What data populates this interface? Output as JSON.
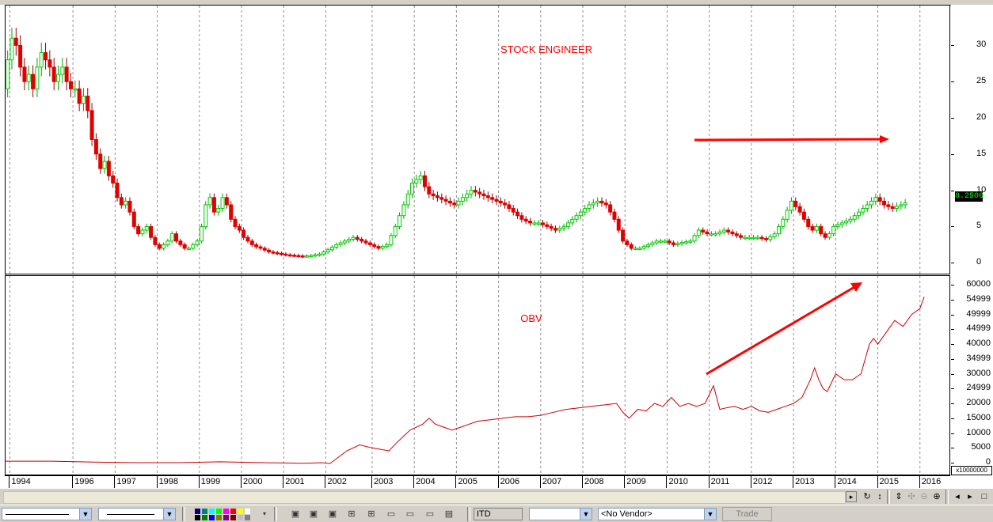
{
  "window": {
    "title": "ITD"
  },
  "chart_data": [
    {
      "type": "candlestick",
      "title": "STOCK ENGINEER",
      "yaxis": {
        "ticks": [
          0,
          5,
          10,
          15,
          20,
          25,
          30
        ],
        "ylim": [
          -1.5,
          35.5
        ],
        "side": "right"
      },
      "last_value_label": "8.2500",
      "xlim": [
        1993.9,
        2016.3
      ],
      "close_series": {
        "x": [
          1993.9,
          1994.0,
          1994.1,
          1994.2,
          1994.3,
          1994.4,
          1994.5,
          1994.6,
          1994.7,
          1994.8,
          1994.9,
          1995.0,
          1995.1,
          1995.2,
          1995.3,
          1995.4,
          1995.5,
          1995.6,
          1995.7,
          1995.8,
          1995.9,
          1996.0,
          1996.1,
          1996.2,
          1996.3,
          1996.4,
          1996.5,
          1996.6,
          1996.7,
          1996.8,
          1996.9,
          1997.0,
          1997.1,
          1997.2,
          1997.3,
          1997.4,
          1997.5,
          1997.6,
          1997.7,
          1997.8,
          1997.9,
          1998.0,
          1998.1,
          1998.2,
          1998.3,
          1998.4,
          1998.5,
          1998.6,
          1998.7,
          1998.8,
          1998.9,
          1999.0,
          1999.1,
          1999.2,
          1999.3,
          1999.4,
          1999.5,
          1999.6,
          1999.7,
          1999.8,
          1999.9,
          2000.0,
          2000.2,
          2000.4,
          2000.6,
          2000.8,
          2001.0,
          2001.2,
          2001.4,
          2001.6,
          2001.8,
          2002.0,
          2002.2,
          2002.4,
          2002.6,
          2002.8,
          2003.0,
          2003.2,
          2003.4,
          2003.6,
          2003.8,
          2003.9,
          2004.0,
          2004.2,
          2004.4,
          2004.6,
          2004.8,
          2005.0,
          2005.2,
          2005.4,
          2005.6,
          2005.8,
          2006.0,
          2006.2,
          2006.4,
          2006.6,
          2006.8,
          2007.0,
          2007.2,
          2007.4,
          2007.6,
          2007.8,
          2008.0,
          2008.2,
          2008.4,
          2008.6,
          2008.8,
          2009.0,
          2009.2,
          2009.4,
          2009.6,
          2009.8,
          2010.0,
          2010.2,
          2010.4,
          2010.6,
          2010.8,
          2011.0,
          2011.2,
          2011.4,
          2011.6,
          2011.8,
          2012.0,
          2012.2,
          2012.4,
          2012.6,
          2012.8,
          2013.0,
          2013.1,
          2013.2,
          2013.3,
          2013.4,
          2013.5,
          2013.6,
          2013.8,
          2014.0,
          2014.2,
          2014.4,
          2014.6,
          2014.8,
          2015.0,
          2015.1,
          2015.2,
          2015.3,
          2015.4,
          2015.5,
          2015.6,
          2015.7
        ],
        "y": [
          24,
          28,
          31,
          30,
          27,
          25,
          26,
          24,
          27,
          29,
          28,
          27,
          25,
          26,
          27,
          25,
          24,
          24,
          22,
          23,
          21,
          17,
          15,
          13,
          14,
          12,
          11,
          9,
          8,
          8.5,
          7,
          5,
          4,
          4.5,
          5,
          3.5,
          2.5,
          2,
          2.5,
          3,
          4,
          3,
          2.5,
          2,
          2,
          2.5,
          3,
          5,
          8,
          9,
          7,
          7.5,
          9,
          8,
          6,
          5,
          4.5,
          3.5,
          3,
          2.5,
          2.2,
          2,
          1.5,
          1.3,
          1.1,
          1,
          0.9,
          1,
          1.2,
          1.8,
          2.5,
          3,
          3.5,
          3,
          2.5,
          2,
          2.5,
          5,
          8,
          11,
          12,
          10.5,
          9.5,
          9,
          8.5,
          8,
          9,
          10,
          9.5,
          9,
          8.5,
          8,
          7,
          6,
          5.5,
          5.5,
          5,
          4.5,
          5,
          6,
          7,
          8,
          8.5,
          8,
          6,
          3,
          2,
          2,
          2.5,
          3,
          3,
          2.5,
          2.8,
          3,
          4.5,
          4,
          4,
          4.5,
          4,
          3.5,
          3.5,
          3.5,
          3.2,
          4,
          6,
          8.5,
          7,
          5,
          4.5,
          5,
          4,
          3.5,
          4,
          5,
          5.5,
          6,
          7,
          8,
          9,
          8,
          7.5,
          7.8,
          8,
          8.25
        ]
      }
    },
    {
      "type": "line",
      "title": "OBV",
      "yaxis": {
        "ticks": [
          "60000",
          "54999",
          "49999",
          "44999",
          "40000",
          "34999",
          "30000",
          "24999",
          "20000",
          "15000",
          "10000",
          "5000",
          "0"
        ],
        "tick_values": [
          60000,
          54999,
          49999,
          44999,
          40000,
          34999,
          30000,
          24999,
          20000,
          15000,
          10000,
          5000,
          0
        ],
        "ylim": [
          -4000,
          63000
        ],
        "side": "right",
        "multiplier_label": "x10000000"
      },
      "x": [
        1993.9,
        1995.0,
        1996.0,
        1997.0,
        1998.0,
        1999.0,
        2000.0,
        2000.6,
        2001.0,
        2001.2,
        2001.4,
        2001.6,
        2002.0,
        2002.3,
        2002.6,
        2003.0,
        2003.2,
        2003.5,
        2003.8,
        2003.95,
        2004.1,
        2004.3,
        2004.5,
        2004.7,
        2004.9,
        2005.1,
        2005.4,
        2005.7,
        2006.0,
        2006.3,
        2006.6,
        2006.9,
        2007.2,
        2007.5,
        2007.8,
        2008.1,
        2008.4,
        2008.55,
        2008.7,
        2008.9,
        2009.1,
        2009.3,
        2009.5,
        2009.7,
        2009.9,
        2010.1,
        2010.3,
        2010.5,
        2010.7,
        2010.85,
        2011.0,
        2011.2,
        2011.4,
        2011.6,
        2011.8,
        2012.0,
        2012.2,
        2012.4,
        2012.6,
        2012.8,
        2013.0,
        2013.1,
        2013.2,
        2013.3,
        2013.4,
        2013.6,
        2013.8,
        2014.0,
        2014.2,
        2014.4,
        2014.5,
        2014.6,
        2014.8,
        2015.0,
        2015.2,
        2015.4,
        2015.6,
        2015.7
      ],
      "y": [
        500,
        500,
        200,
        0,
        0,
        300,
        0,
        -100,
        -200,
        -100,
        0,
        -300,
        4000,
        6000,
        5000,
        4000,
        7000,
        11000,
        13000,
        15000,
        13000,
        12000,
        11000,
        12000,
        13000,
        14000,
        14500,
        15000,
        15500,
        15500,
        16000,
        17000,
        18000,
        18500,
        19000,
        19500,
        20000,
        17000,
        15000,
        18000,
        17500,
        20000,
        19000,
        22000,
        19000,
        20000,
        19000,
        20000,
        26000,
        18000,
        18500,
        19000,
        18000,
        19000,
        17500,
        17000,
        18000,
        19000,
        20000,
        22000,
        28000,
        32000,
        28000,
        25000,
        24000,
        30000,
        28000,
        28000,
        30000,
        40000,
        42000,
        40000,
        44000,
        48000,
        46000,
        50000,
        52000,
        56000
      ]
    }
  ],
  "annotations": {
    "price_arrow": "horizontal-right",
    "obv_arrow": "rising"
  },
  "x_axis_years": [
    "1994",
    "1996",
    "1997",
    "1998",
    "1999",
    "2000",
    "2001",
    "2002",
    "2003",
    "2004",
    "2005",
    "2006",
    "2007",
    "2008",
    "2009",
    "2010",
    "2011",
    "2012",
    "2013",
    "2014",
    "2015",
    "2016"
  ],
  "year_positions": [
    1994.0,
    1995.5,
    1996.5,
    1997.5,
    1998.5,
    1999.5,
    2000.5,
    2001.5,
    2002.6,
    2003.6,
    2004.6,
    2005.6,
    2006.6,
    2007.6,
    2008.6,
    2009.6,
    2010.6,
    2011.6,
    2012.6,
    2013.6,
    2014.6,
    2015.6
  ],
  "colors": {
    "up": "#00cc00",
    "down": "#e00000",
    "obv_line": "#cc0000",
    "annotation": "#ff0000"
  },
  "toolbar": {
    "timeframe": "ITD",
    "vendor": "<No Vendor>",
    "trade_label": "Trade"
  }
}
